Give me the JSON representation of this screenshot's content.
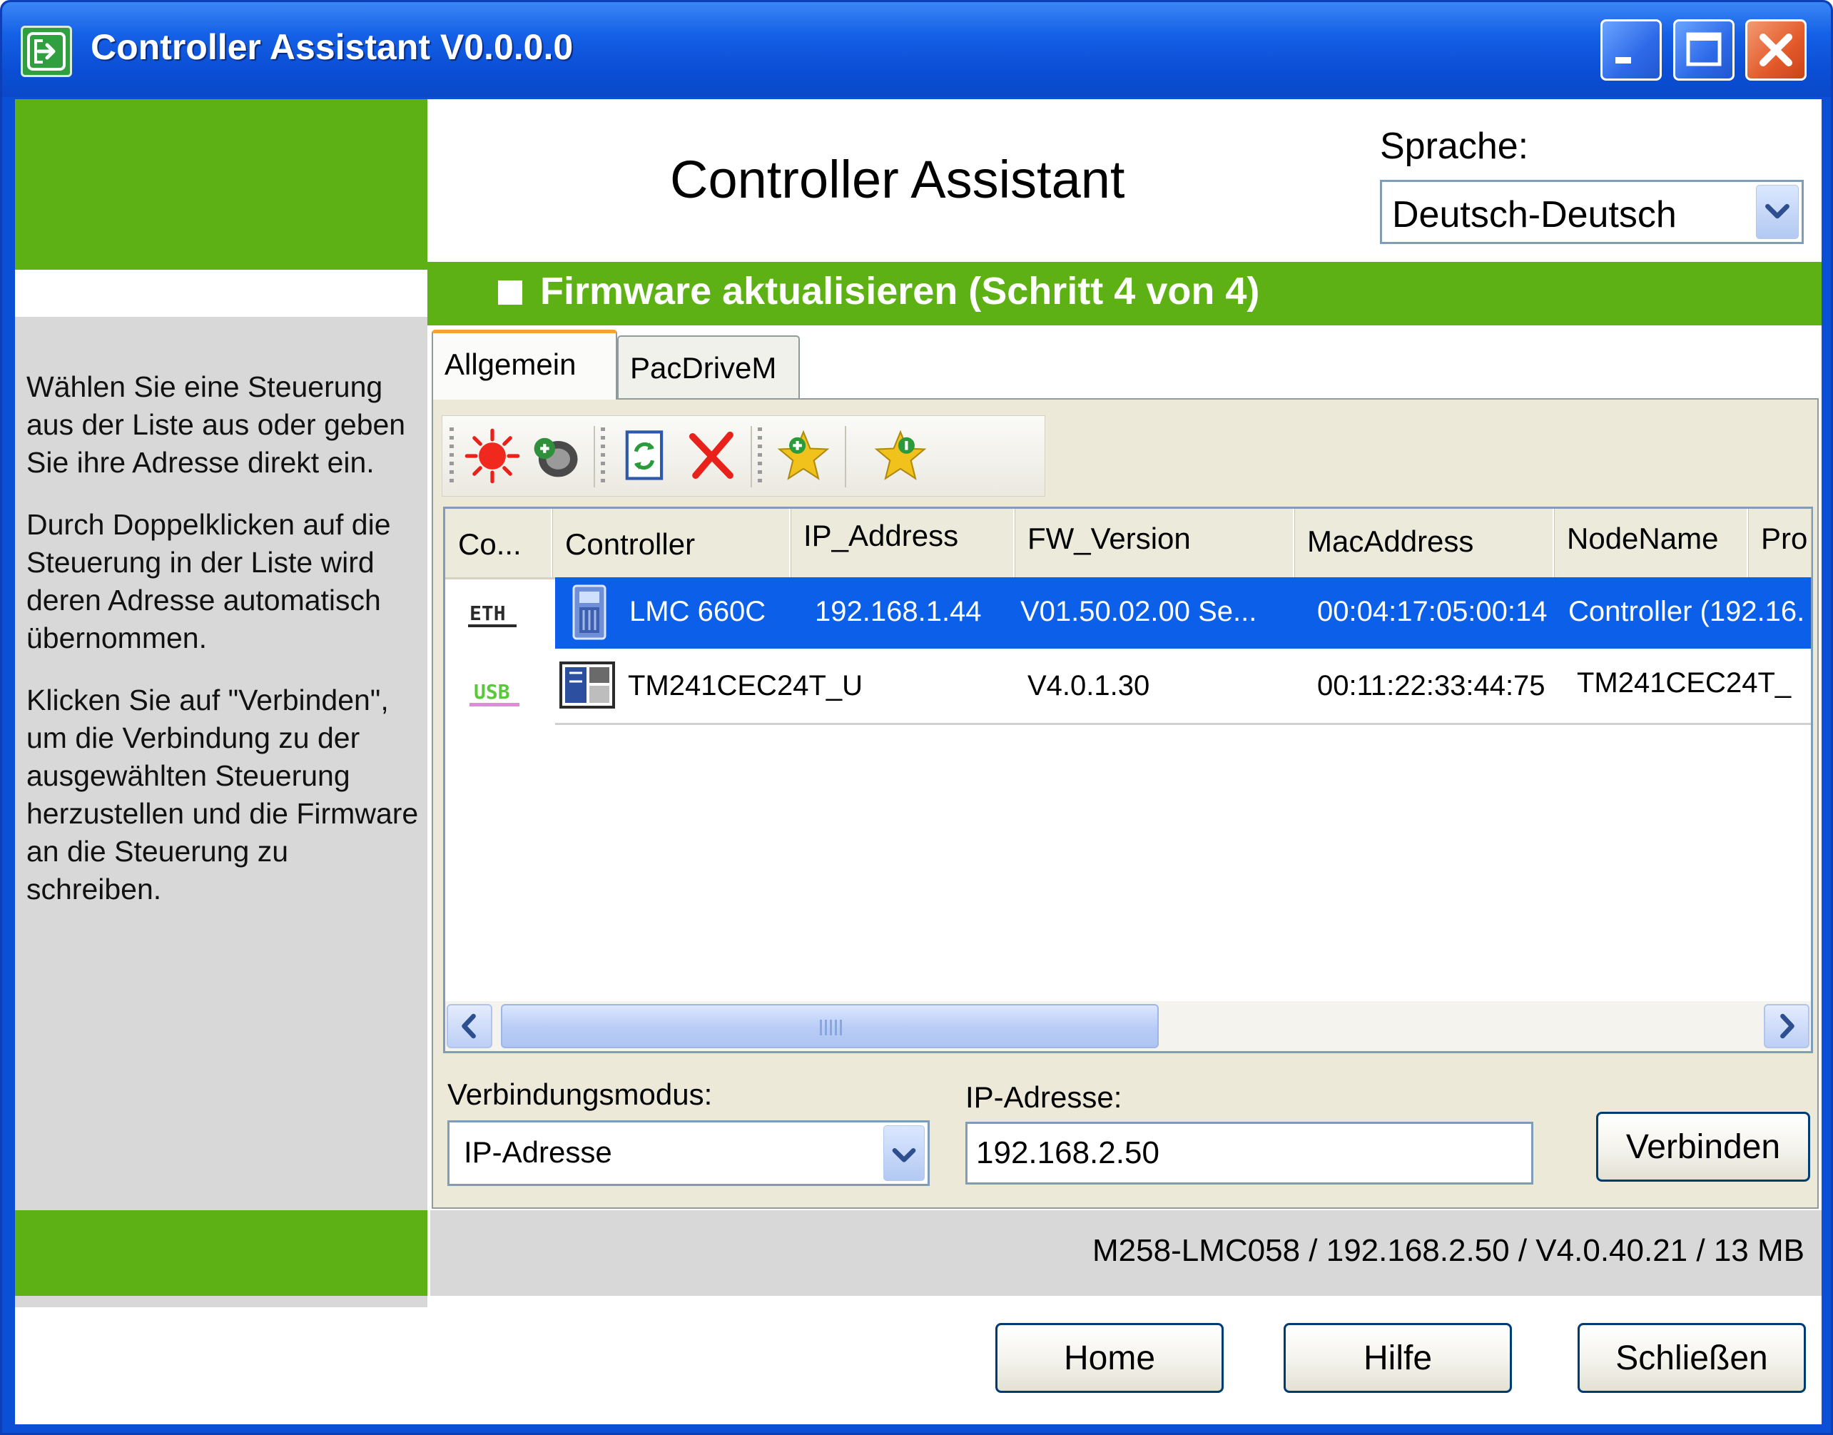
{
  "window": {
    "title": "Controller Assistant V0.0.0.0"
  },
  "header": {
    "app_heading": "Controller Assistant",
    "language_label": "Sprache:",
    "language_value": "Deutsch-Deutsch"
  },
  "step": {
    "title": "Firmware aktualisieren (Schritt 4 von 4)"
  },
  "instructions": {
    "p1": "Wählen Sie eine Steuerung aus der Liste aus oder geben Sie ihre Adresse direkt ein.",
    "p2": "Durch Doppelklicken auf die Steuerung in der Liste wird deren Adresse automatisch übernommen.",
    "p3": "Klicken Sie auf \"Verbinden\", um die Verbindung zu der ausgewählten Steuerung herzustellen und die Firmware an die Steuerung zu schreiben."
  },
  "tabs": [
    {
      "label": "Allgemein",
      "active": true
    },
    {
      "label": "PacDriveM",
      "active": false
    }
  ],
  "toolbar": {
    "icons": [
      "refresh-scan-icon",
      "connection-settings-icon",
      "update-list-icon",
      "delete-icon",
      "add-favorite-icon",
      "favorite-icon"
    ]
  },
  "table": {
    "columns": [
      "Co...",
      "Controller",
      "IP_Address",
      "FW_Version",
      "MacAddress",
      "NodeName",
      "Pro"
    ],
    "rows": [
      {
        "connection": "ETH",
        "controller": "LMC 660C",
        "ip": "192.168.1.44",
        "fw": "V01.50.02.00 Se...",
        "mac": "00:04:17:05:00:14",
        "node": "Controller (192.16.",
        "selected": true
      },
      {
        "connection": "USB",
        "controller": "TM241CEC24T_U",
        "ip": "",
        "fw": "V4.0.1.30",
        "mac": "00:11:22:33:44:75",
        "node": "TM241CEC24T_",
        "selected": false
      }
    ]
  },
  "connection": {
    "mode_label": "Verbindungsmodus:",
    "mode_value": "IP-Adresse",
    "ip_label": "IP-Adresse:",
    "ip_value": "192.168.2.50",
    "connect_button": "Verbinden"
  },
  "status": {
    "text": "M258-LMC058 / 192.168.2.50 / V4.0.40.21 / 13 MB"
  },
  "footer": {
    "home": "Home",
    "help": "Hilfe",
    "close": "Schließen"
  },
  "colors": {
    "accent_green": "#5eb114",
    "titlebar_blue": "#0b4fd6",
    "selection_blue": "#0b5fe8",
    "panel_gray": "#d8d8d8"
  }
}
